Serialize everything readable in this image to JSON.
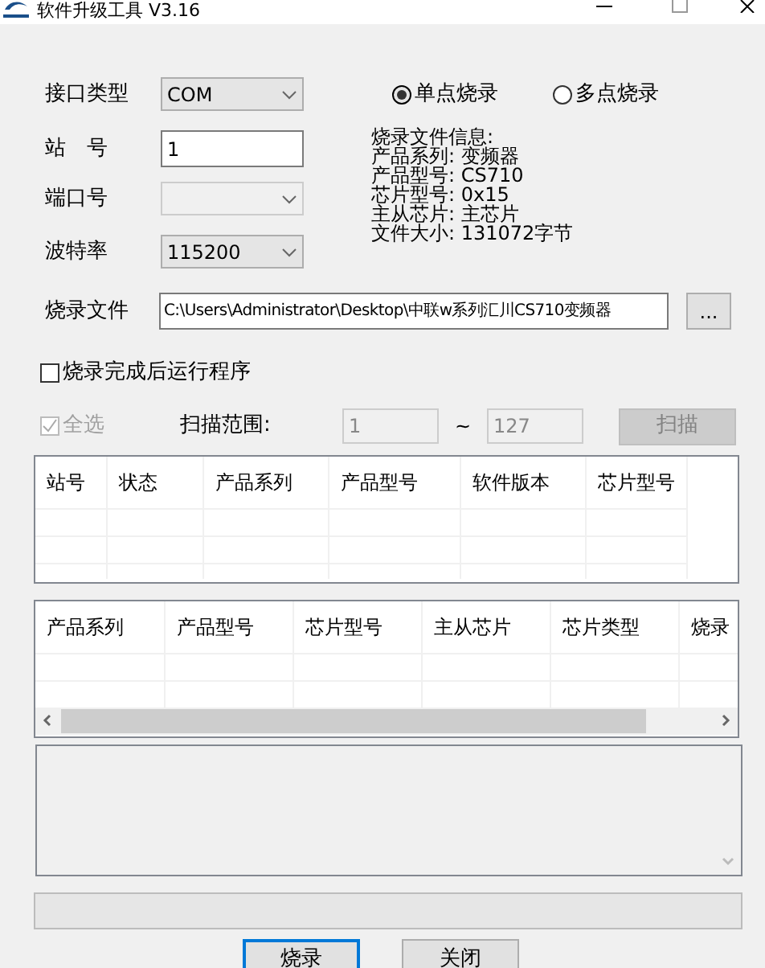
{
  "window": {
    "title": "软件升级工具 V3.16"
  },
  "form": {
    "interface_type": {
      "label": "接口类型",
      "value": "COM",
      "disabled": false
    },
    "station": {
      "label": "站　号",
      "value": "1"
    },
    "port": {
      "label": "端口号",
      "disabled": true
    },
    "baud": {
      "label": "波特率",
      "value": "115200",
      "disabled": false
    }
  },
  "modes": [
    {
      "label": "单点烧录",
      "selected": true
    },
    {
      "label": "多点烧录",
      "selected": false
    }
  ],
  "file_info": [
    "烧录文件信息:",
    "产品系列: 变频器",
    "产品型号: CS710",
    "芯片型号: 0x15",
    "主从芯片: 主芯片",
    "文件大小: 131072字节"
  ],
  "burn_file": {
    "label": "烧录文件",
    "value": "C:\\Users\\Administrator\\Desktop\\中联w系列汇川CS710变频器",
    "browse": "..."
  },
  "run_after": {
    "label": "烧录完成后运行程序",
    "checked": false
  },
  "select_all": {
    "label": "全选",
    "checked": true,
    "disabled": true
  },
  "scan": {
    "label": "扫描范围:",
    "from": "1",
    "separator": "~",
    "to": "127",
    "button": "扫描",
    "disabled": true
  },
  "device_table": {
    "columns": [
      "站号",
      "状态",
      "产品系列",
      "产品型号",
      "软件版本",
      "芯片型号"
    ]
  },
  "file_table": {
    "columns": [
      "产品系列",
      "产品型号",
      "芯片型号",
      "主从芯片",
      "芯片类型",
      "烧录"
    ]
  },
  "progress": {
    "level": 0
  },
  "buttons": [
    {
      "label": "烧录",
      "selected": true
    },
    {
      "label": "关闭",
      "selected": false
    }
  ]
}
